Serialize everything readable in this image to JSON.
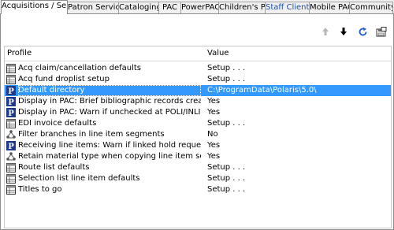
{
  "tabs": [
    {
      "label": "Acquisitions / Serials",
      "active": true
    },
    {
      "label": "Patron Services"
    },
    {
      "label": "Cataloging"
    },
    {
      "label": "PAC"
    },
    {
      "label": "PowerPAC"
    },
    {
      "label": "Children's PAC"
    },
    {
      "label": "Staff Client"
    },
    {
      "label": "Mobile PAC"
    },
    {
      "label": "Community"
    }
  ],
  "toolbar": {
    "icons": [
      "arrow-up-icon",
      "arrow-down-icon",
      "refresh-icon",
      "save-icon"
    ]
  },
  "grid": {
    "columns": {
      "profile": "Profile",
      "value": "Value"
    },
    "rows": [
      {
        "name": "Acq claim/cancellation defaults",
        "value": "Setup . . .",
        "icon": "table-icon"
      },
      {
        "name": "Acq fund droplist setup",
        "value": "Setup . . .",
        "icon": "table-icon"
      },
      {
        "name": "Default directory",
        "value": "C:\\ProgramData\\Polaris\\5.0\\",
        "icon": "polaris-p-icon",
        "selected": true
      },
      {
        "name": "Display in PAC: Brief bibliographic records created from ...",
        "value": "Yes",
        "icon": "polaris-p-icon"
      },
      {
        "name": "Display in PAC: Warn if unchecked at POLI/INLI save",
        "value": "Yes",
        "icon": "polaris-p-icon"
      },
      {
        "name": "EDI invoice defaults",
        "value": "Setup . . .",
        "icon": "table-icon"
      },
      {
        "name": "Filter branches in line item segments",
        "value": "No",
        "icon": "network-icon"
      },
      {
        "name": "Receiving line items: Warn if linked hold requests",
        "value": "Yes",
        "icon": "polaris-p-icon"
      },
      {
        "name": "Retain material type when copying line item segment data",
        "value": "Yes",
        "icon": "network-icon"
      },
      {
        "name": "Route list defaults",
        "value": "Setup . . .",
        "icon": "table-icon"
      },
      {
        "name": "Selection list line item defaults",
        "value": "Setup . . .",
        "icon": "table-icon"
      },
      {
        "name": "Titles to go",
        "value": "Setup . . .",
        "icon": "table-icon"
      }
    ]
  }
}
